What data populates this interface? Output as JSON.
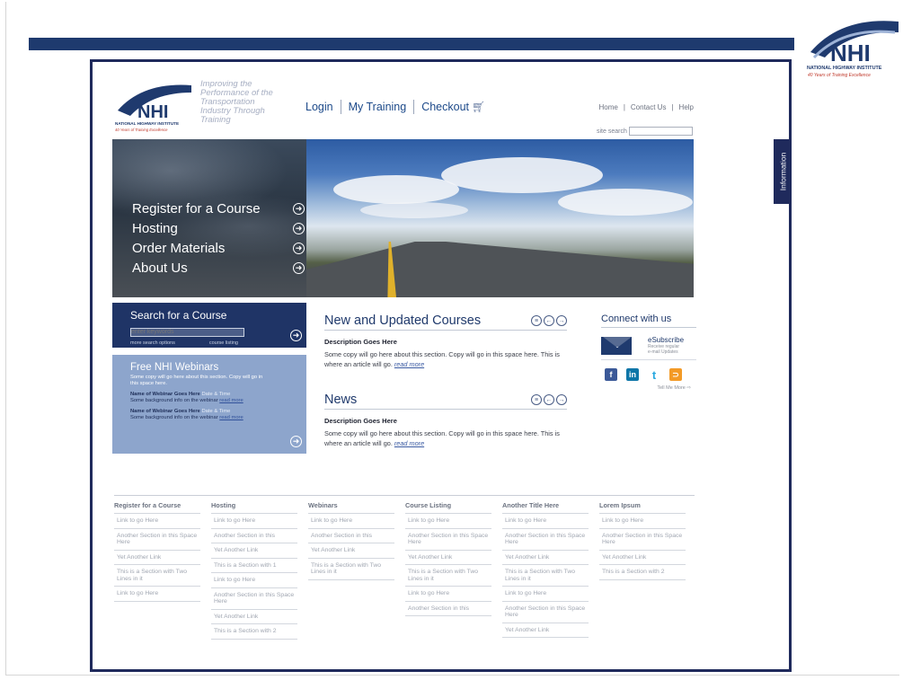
{
  "corner_logo": {
    "number": "40",
    "letters": "NHI",
    "name": "NATIONAL HIGHWAY INSTITUTE",
    "slogan": "40 Years of Training Excellence"
  },
  "site_logo": {
    "number": "40",
    "letters": "NHI",
    "name": "NATIONAL HIGHWAY INSTITUTE",
    "slogan": "40 Years of Training Excellence"
  },
  "tagline": "Improving the Performance of the Transportation Industry Through Training",
  "main_nav": {
    "login": "Login",
    "my_training": "My Training",
    "checkout": "Checkout"
  },
  "util_nav": {
    "home": "Home",
    "contact": "Contact Us",
    "help": "Help",
    "sep": "|"
  },
  "site_search": {
    "label": "site search"
  },
  "info_tab": "Information",
  "hero_menu": [
    "Register for a Course",
    "Hosting",
    "Order Materials",
    "About Us"
  ],
  "search_course": {
    "title": "Search for a Course",
    "placeholder": "enter keywords",
    "more_options": "more search options",
    "course_listing": "course listing"
  },
  "webinars": {
    "title": "Free NHI Webinars",
    "intro": "Some copy will go here about this section. Copy will go in this space here.",
    "items": [
      {
        "name": "Name of Webinar Goes Here",
        "date": "Date & Time",
        "bg": "Some background info on the webinar",
        "more": "read more"
      },
      {
        "name": "Name of Webinar Goes Here",
        "date": "Date & Time",
        "bg": "Some background info on the webinar",
        "more": "read more"
      }
    ]
  },
  "courses": {
    "title": "New and Updated Courses",
    "desc_title": "Description Goes Here",
    "desc_body": "Some copy will go here about this section. Copy will go in this space here. This is where an article will go.",
    "more": "read more"
  },
  "news": {
    "title": "News",
    "desc_title": "Description Goes Here",
    "desc_body": "Some copy will go here about this section. Copy will go in this space here. This is where an article will go.",
    "more": "read more"
  },
  "connect": {
    "title": "Connect with us",
    "esub_title": "eSubscribe",
    "esub_sub1": "Receive regular",
    "esub_sub2": "e-mail Updates",
    "tell_me_more": "Tell Me More"
  },
  "footer": [
    {
      "heading": "Register for a Course",
      "links": [
        "Link to go Here",
        "Another Section in this Space Here",
        "Yet Another Link",
        "This is a Section with Two Lines in it",
        "Link to go Here"
      ]
    },
    {
      "heading": "Hosting",
      "links": [
        "Link to go Here",
        "Another Section in this",
        "Yet Another Link",
        "This is a Section with 1",
        "Link to go Here",
        "Another Section in this Space Here",
        "Yet Another Link",
        "This is a Section with 2"
      ]
    },
    {
      "heading": "Webinars",
      "links": [
        "Link to go Here",
        "Another Section in this",
        "Yet Another Link",
        "This is a Section with Two Lines in it"
      ]
    },
    {
      "heading": "Course Listing",
      "links": [
        "Link to go Here",
        "Another Section in this Space Here",
        "Yet Another Link",
        "This is a Section with Two Lines in it",
        "Link to go Here",
        "Another Section in this"
      ]
    },
    {
      "heading": "Another Title Here",
      "links": [
        "Link to go Here",
        "Another Section in this Space Here",
        "Yet Another Link",
        "This is a Section with Two Lines in it",
        "Link to go Here",
        "Another Section in this Space Here",
        "Yet Another Link"
      ]
    },
    {
      "heading": "Lorem Ipsum",
      "links": [
        "Link to go Here",
        "Another Section in this Space Here",
        "Yet Another Link",
        "This is a Section with 2"
      ]
    }
  ],
  "colors": {
    "navy": "#1f2a5c",
    "bar": "#1e3a6e",
    "webinar_bg": "#8da5cc",
    "road_line": "#e0b12b"
  }
}
